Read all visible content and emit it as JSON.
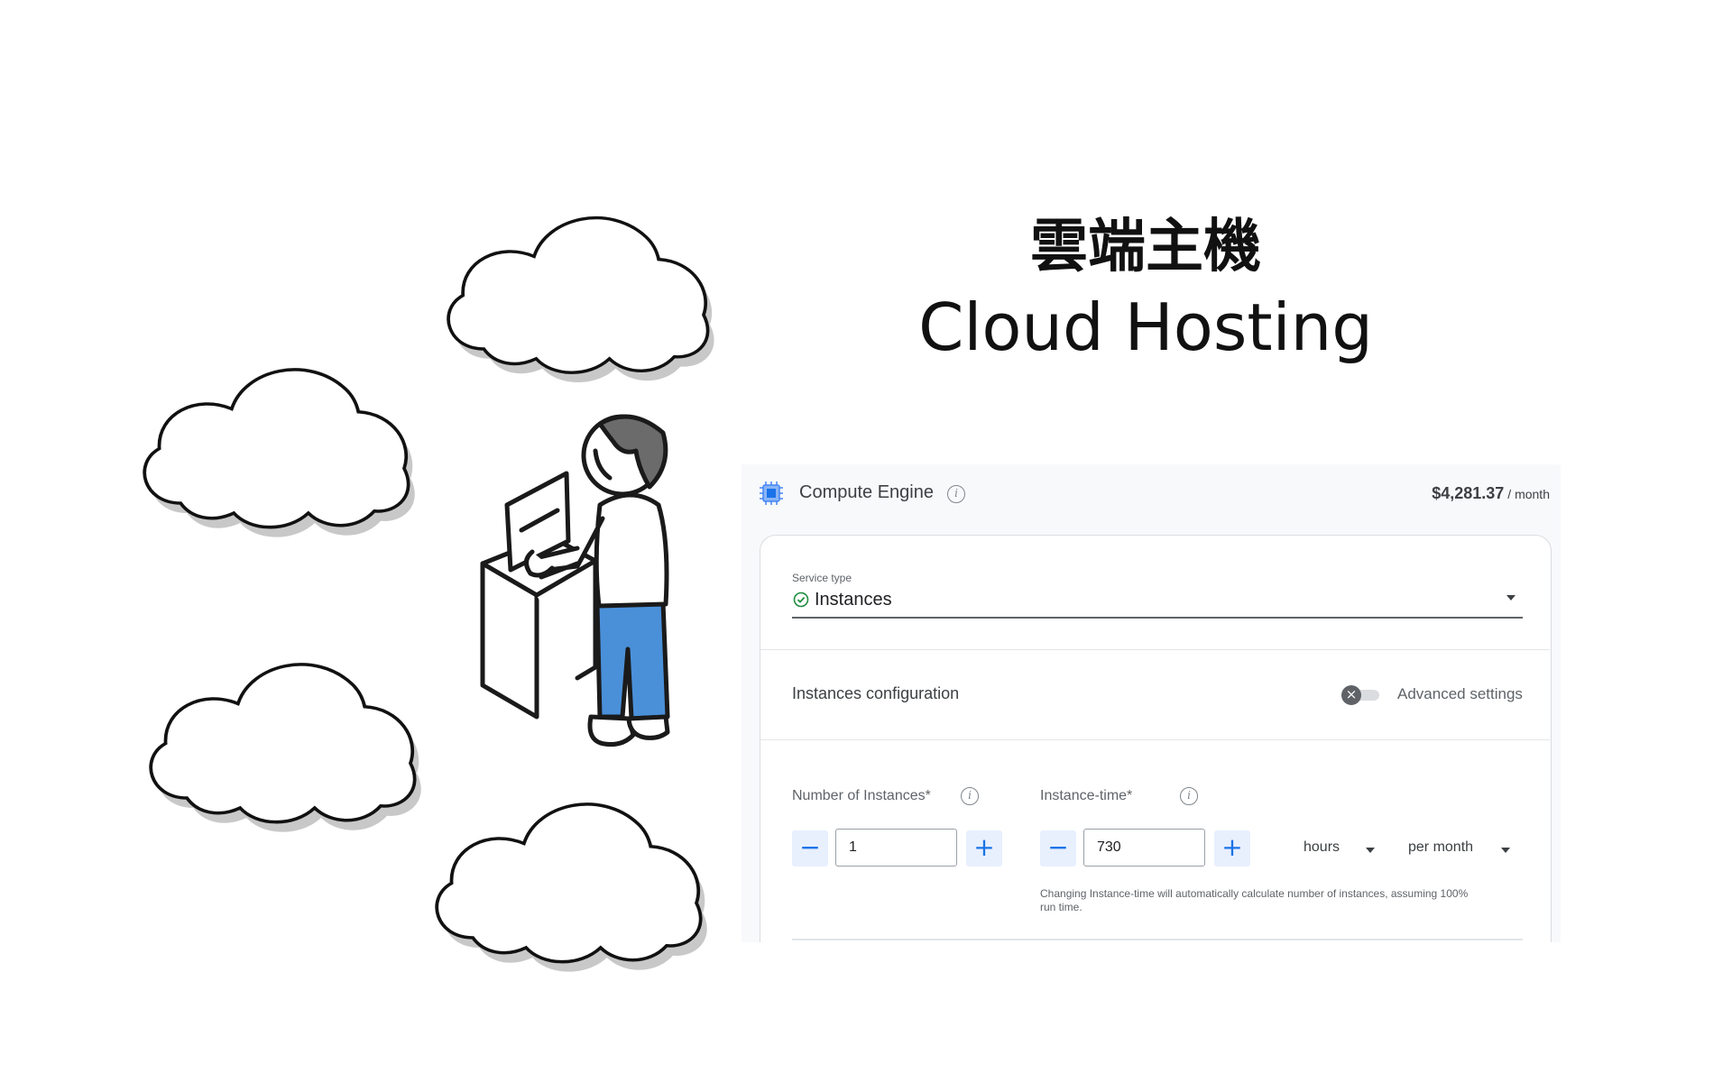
{
  "title": {
    "zh": "雲端主機",
    "en": "Cloud Hosting"
  },
  "illustration": {
    "description_icons": [
      "cloud-icon",
      "person-at-laptop-icon"
    ]
  },
  "panel": {
    "name": "Compute Engine",
    "price_amount": "$4,281.37",
    "price_unit": "/ month",
    "service_type_label": "Service type",
    "service_type_value": "Instances",
    "config_label": "Instances configuration",
    "advanced_label": "Advanced settings",
    "instances": {
      "label": "Number of Instances*",
      "value": "1"
    },
    "instance_time": {
      "label": "Instance-time*",
      "value": "730",
      "unit": "hours",
      "period": "per month"
    },
    "helper_text": "Changing Instance-time will automatically calculate number of instances, assuming 100% run time."
  },
  "colors": {
    "accent": "#1a73e8",
    "accent_light": "#e8f0fe",
    "jeans": "#4a90d9",
    "check_green": "#1e8e3e"
  }
}
